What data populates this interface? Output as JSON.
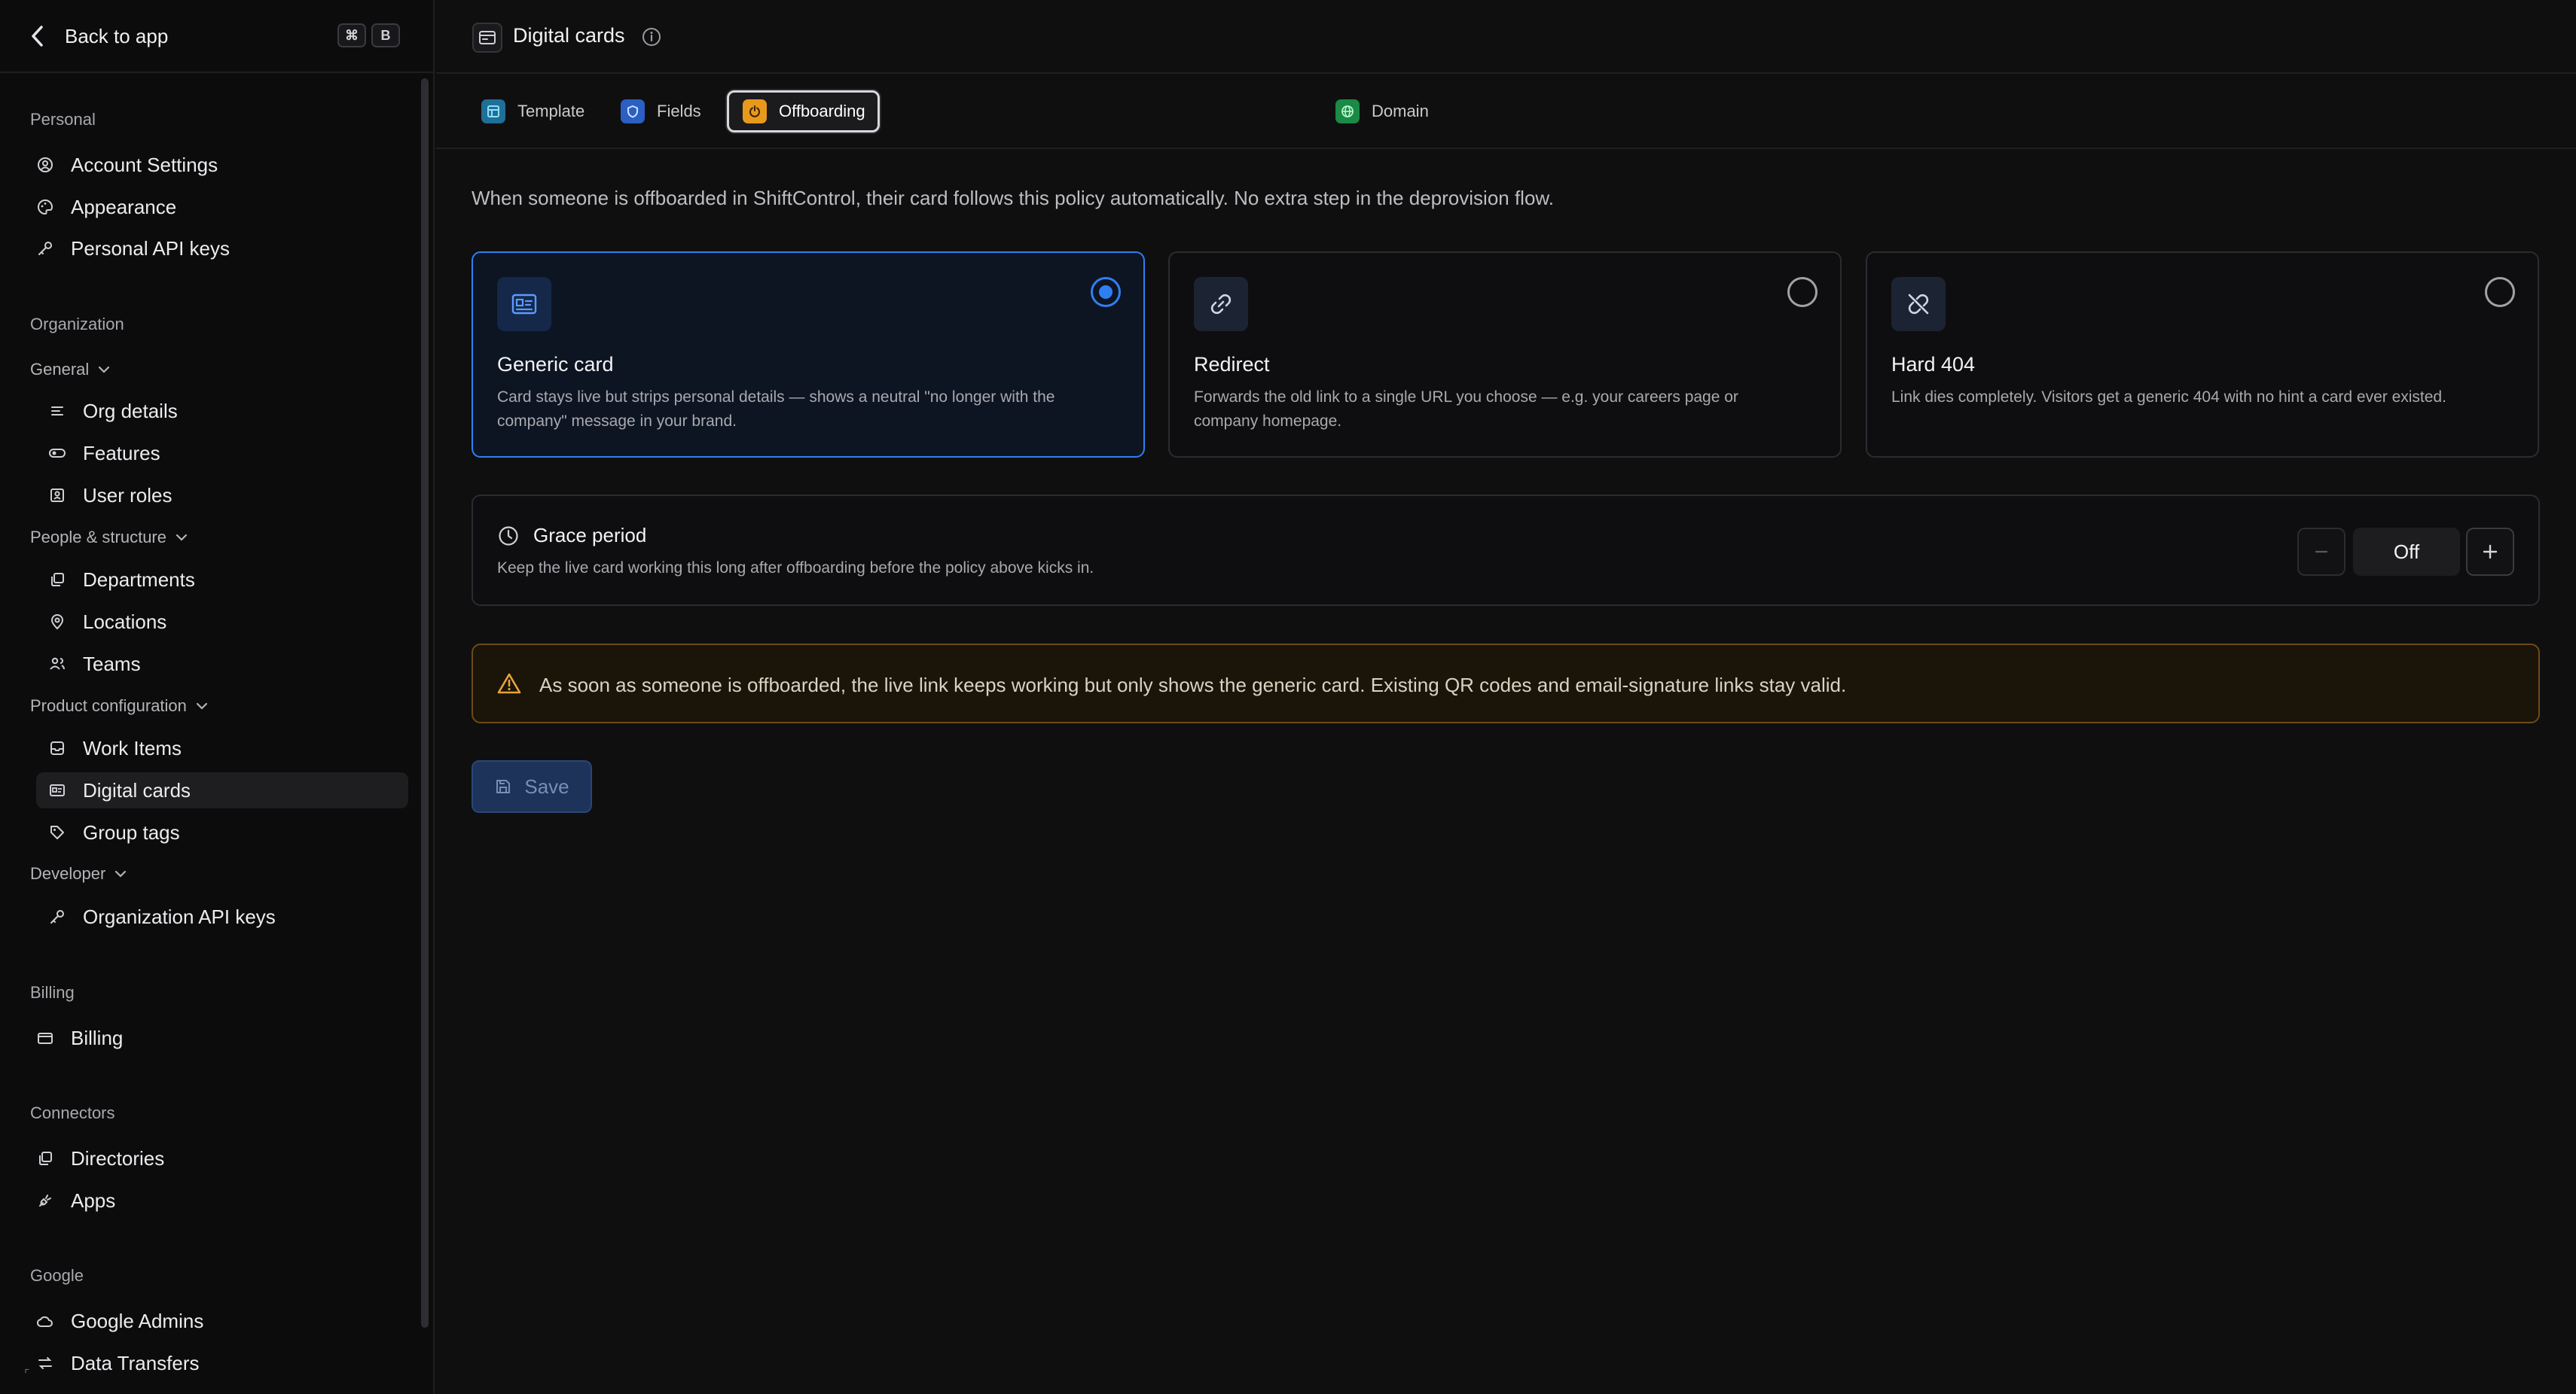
{
  "sidebar": {
    "back_label": "Back to app",
    "shortcut": [
      "⌘",
      "B"
    ],
    "sections": {
      "personal": "Personal",
      "organization": "Organization",
      "billing": "Billing",
      "connectors": "Connectors",
      "google": "Google"
    },
    "groups": {
      "general": "General",
      "people": "People & structure",
      "product": "Product configuration",
      "developer": "Developer"
    },
    "items": {
      "account_settings": "Account Settings",
      "appearance": "Appearance",
      "personal_api_keys": "Personal API keys",
      "org_details": "Org details",
      "features": "Features",
      "user_roles": "User roles",
      "departments": "Departments",
      "locations": "Locations",
      "teams": "Teams",
      "work_items": "Work Items",
      "digital_cards": "Digital cards",
      "group_tags": "Group tags",
      "org_api_keys": "Organization API keys",
      "billing": "Billing",
      "directories": "Directories",
      "apps": "Apps",
      "google_admins": "Google Admins",
      "data_transfers": "Data Transfers"
    },
    "active_item": "Digital cards"
  },
  "header": {
    "title": "Digital cards"
  },
  "tabs": [
    {
      "label": "Template",
      "icon": "template-icon",
      "color": "#2aa7e0"
    },
    {
      "label": "Fields",
      "icon": "shield-icon",
      "color": "#3b7cf0"
    },
    {
      "label": "Offboarding",
      "icon": "power-icon",
      "color": "#f0a020",
      "active": true
    },
    {
      "label": "Domain",
      "icon": "globe-icon",
      "color": "#22b455"
    }
  ],
  "main": {
    "intro": "When someone is offboarded in ShiftControl, their card follows this policy automatically. No extra step in the deprovision flow.",
    "options": [
      {
        "title": "Generic card",
        "desc": "Card stays live but strips personal details — shows a neutral \"no longer with the company\" message in your brand.",
        "icon": "id-card-icon",
        "selected": true
      },
      {
        "title": "Redirect",
        "desc": "Forwards the old link to a single URL you choose — e.g. your careers page or company homepage.",
        "icon": "link-icon",
        "selected": false
      },
      {
        "title": "Hard 404",
        "desc": "Link dies completely. Visitors get a generic 404 with no hint a card ever existed.",
        "icon": "broken-link-icon",
        "selected": false
      }
    ],
    "grace": {
      "title": "Grace period",
      "desc": "Keep the live card working this long after offboarding before the policy above kicks in.",
      "value": "Off"
    },
    "alert": "As soon as someone is offboarded, the live link keeps working but only shows the generic card. Existing QR codes and email-signature links stay valid.",
    "save_label": "Save"
  },
  "colors": {
    "accent": "#2f7ff2",
    "warning": "#e8a33a",
    "background": "#0f0f10"
  }
}
